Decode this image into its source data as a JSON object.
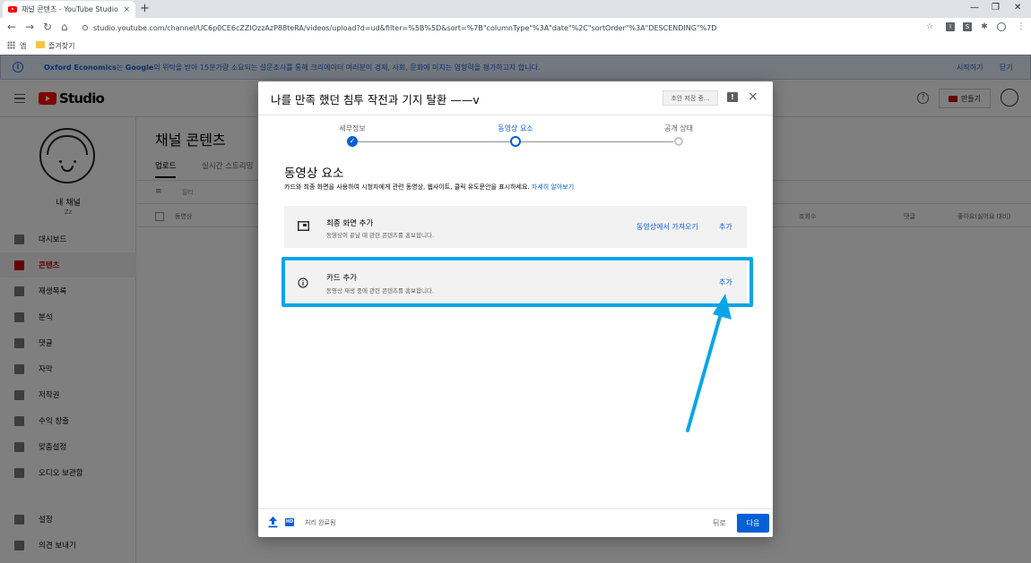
{
  "browser": {
    "tab_title": "채널 콘텐츠 - YouTube Studio",
    "tab_close": "×",
    "new_tab": "+",
    "url": "studio.youtube.com/channel/UC6p0CE6cZZIOzzAzP88teRA/videos/upload?d=ud&filter=%5B%5D&sort=%7B\"columnType\"%3A\"date\"%2C\"sortOrder\"%3A\"DESCENDING\"%7D",
    "bookmarks": {
      "apps": "앱",
      "favorites": "즐겨찾기"
    }
  },
  "infobar": {
    "brand": "Oxford Economics",
    "message_mid": "는 ",
    "google": "Google",
    "message_rest": "의 위탁을 받아 15분가량 소요되는 설문조사를 통해 크리에이터 여러분이 경제, 사회, 문화에 미치는 영향력을 평가하고자 합니다.",
    "start": "시작하기",
    "close": "닫기"
  },
  "studio": {
    "logo_text": "Studio",
    "create_label": "만들기",
    "channel_name": "내 채널",
    "channel_handle": "Zz",
    "sidebar": [
      {
        "label": "대시보드",
        "icon": "dashboard-icon"
      },
      {
        "label": "콘텐츠",
        "icon": "content-icon",
        "active": true
      },
      {
        "label": "재생목록",
        "icon": "playlist-icon"
      },
      {
        "label": "분석",
        "icon": "analytics-icon"
      },
      {
        "label": "댓글",
        "icon": "comments-icon"
      },
      {
        "label": "자막",
        "icon": "subtitles-icon"
      },
      {
        "label": "저작권",
        "icon": "copyright-icon"
      },
      {
        "label": "수익 창출",
        "icon": "monetization-icon"
      },
      {
        "label": "맞춤설정",
        "icon": "customization-icon"
      },
      {
        "label": "오디오 보관함",
        "icon": "audio-library-icon"
      }
    ],
    "sidebar_bottom": [
      {
        "label": "설정",
        "icon": "settings-icon"
      },
      {
        "label": "의견 보내기",
        "icon": "feedback-icon"
      }
    ],
    "page_title": "채널 콘텐츠",
    "tabs": [
      "업로드",
      "실시간 스트리밍"
    ],
    "filter_placeholder": "필터",
    "columns": [
      "동영상",
      "조회수",
      "댓글",
      "좋아요(싫어요 대비)"
    ]
  },
  "dialog": {
    "title": "나를 만족 했던 침투 작전과 기지 탈환 ——v",
    "draft_button": "초안 저장 중...",
    "feedback_icon": "!",
    "close": "×",
    "steps": [
      {
        "label": "세부정보",
        "state": "done"
      },
      {
        "label": "동영상 요소",
        "state": "active"
      },
      {
        "label": "공개 상태",
        "state": "todo"
      }
    ],
    "section_title": "동영상 요소",
    "section_desc": "카드와 최종 화면을 사용하여 시청자에게 관련 동영상, 웹사이트, 클릭 유도문안을 표시하세요. ",
    "learn_more": "자세히 알아보기",
    "end_screen": {
      "title": "최종 화면 추가",
      "subtitle": "동영상이 끝날 때 관련 콘텐츠를 홍보합니다.",
      "import_label": "동영상에서 가져오기",
      "add_label": "추가"
    },
    "cards": {
      "title": "카드 추가",
      "subtitle": "동영상 재생 중에 관련 콘텐츠를 홍보합니다.",
      "add_label": "추가"
    },
    "hd_badge": "HD",
    "status": "처리 완료됨",
    "back": "뒤로",
    "next": "다음"
  },
  "annotation": {
    "color": "#0aa5e6"
  }
}
